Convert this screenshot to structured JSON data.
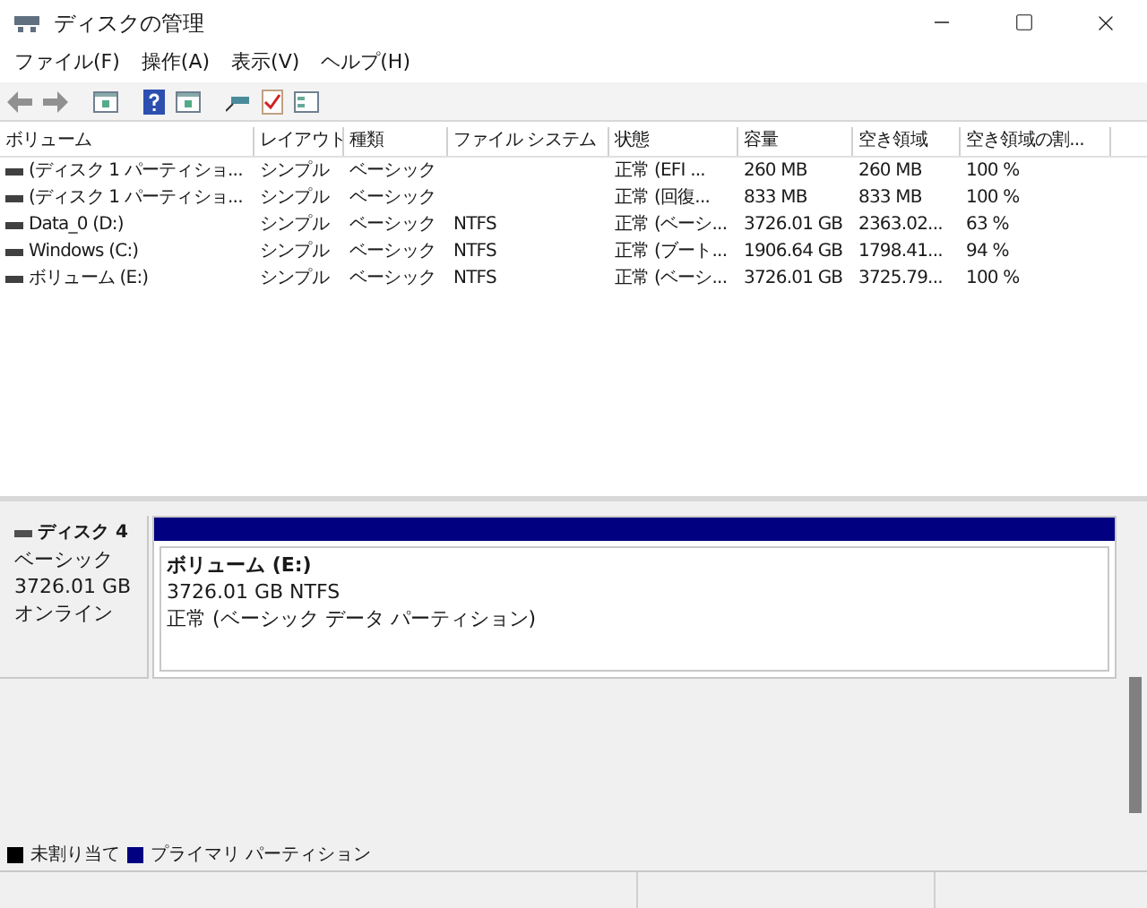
{
  "window": {
    "title": "ディスクの管理"
  },
  "menu": [
    "ファイル(F)",
    "操作(A)",
    "表示(V)",
    "ヘルプ(H)"
  ],
  "table": {
    "columns": [
      "ボリューム",
      "レイアウト",
      "種類",
      "ファイル システム",
      "状態",
      "容量",
      "空き領域",
      "空き領域の割..."
    ],
    "rows": [
      [
        "(ディスク 1 パーティショ...",
        "シンプル",
        "ベーシック",
        "",
        "正常 (EFI ...",
        "260 MB",
        "260 MB",
        "100 %"
      ],
      [
        "(ディスク 1 パーティショ...",
        "シンプル",
        "ベーシック",
        "",
        "正常 (回復...",
        "833 MB",
        "833 MB",
        "100 %"
      ],
      [
        "Data_0 (D:)",
        "シンプル",
        "ベーシック",
        "NTFS",
        "正常 (ベーシ...",
        "3726.01 GB",
        "2363.02...",
        "63 %"
      ],
      [
        "Windows (C:)",
        "シンプル",
        "ベーシック",
        "NTFS",
        "正常 (ブート...",
        "1906.64 GB",
        "1798.41...",
        "94 %"
      ],
      [
        "ボリューム (E:)",
        "シンプル",
        "ベーシック",
        "NTFS",
        "正常 (ベーシ...",
        "3726.01 GB",
        "3725.79...",
        "100 %"
      ]
    ]
  },
  "disk": {
    "name": "ディスク 4",
    "type": "ベーシック",
    "size": "3726.01 GB",
    "status": "オンライン",
    "partition": {
      "color": "#000080",
      "name": "ボリューム (E:)",
      "detail": "3726.01 GB NTFS",
      "status": "正常 (ベーシック データ パーティション)"
    }
  },
  "legend": [
    {
      "label": "未割り当て",
      "color": "#000000"
    },
    {
      "label": "プライマリ パーティション",
      "color": "#000080"
    }
  ]
}
